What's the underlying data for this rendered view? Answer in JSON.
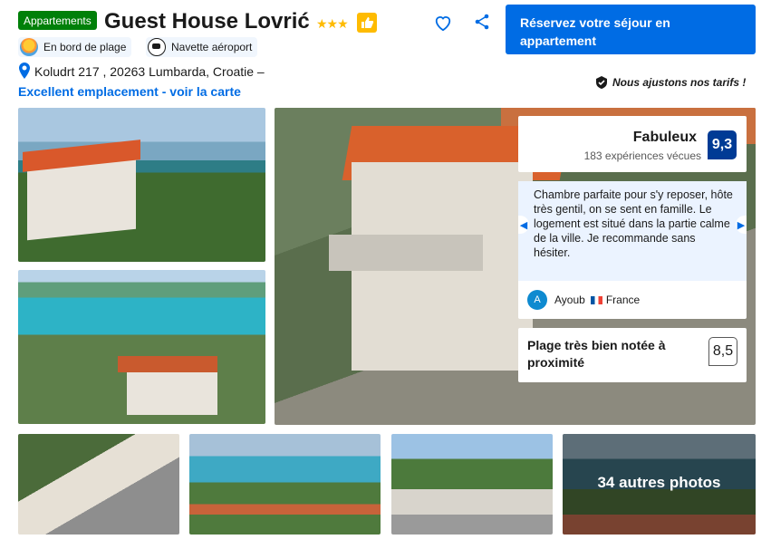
{
  "header": {
    "property_type": "Appartements",
    "title": "Guest House Lovrić",
    "stars": "★★★",
    "reserve_button": "Réservez votre séjour en appartement"
  },
  "facilities": [
    {
      "label": "En bord de plage",
      "icon": "beach-icon"
    },
    {
      "label": "Navette aéroport",
      "icon": "shuttle-icon"
    }
  ],
  "location": {
    "address": "Koludrt 217 , 20263 Lumbarda, Croatie –",
    "map_link": "Excellent emplacement - voir la carte"
  },
  "price_note": "Nous ajustons nos tarifs !",
  "score": {
    "word": "Fabuleux",
    "count": "183 expériences vécues",
    "value": "9,3"
  },
  "review": {
    "text": "Chambre parfaite pour s'y reposer, hôte très gentil, on se sent en famille. Le logement est situé dans la partie calme de la ville. Je recommande sans hésiter.",
    "avatar_letter": "A",
    "author": "Ayoub",
    "country": "France"
  },
  "beach": {
    "label": "Plage très bien notée à proximité",
    "score": "8,5"
  },
  "gallery": {
    "more_photos": "34 autres photos"
  },
  "colors": {
    "brand_blue": "#006ce4",
    "score_blue": "#003b95",
    "green_badge": "#008009",
    "star_yellow": "#febb02"
  }
}
